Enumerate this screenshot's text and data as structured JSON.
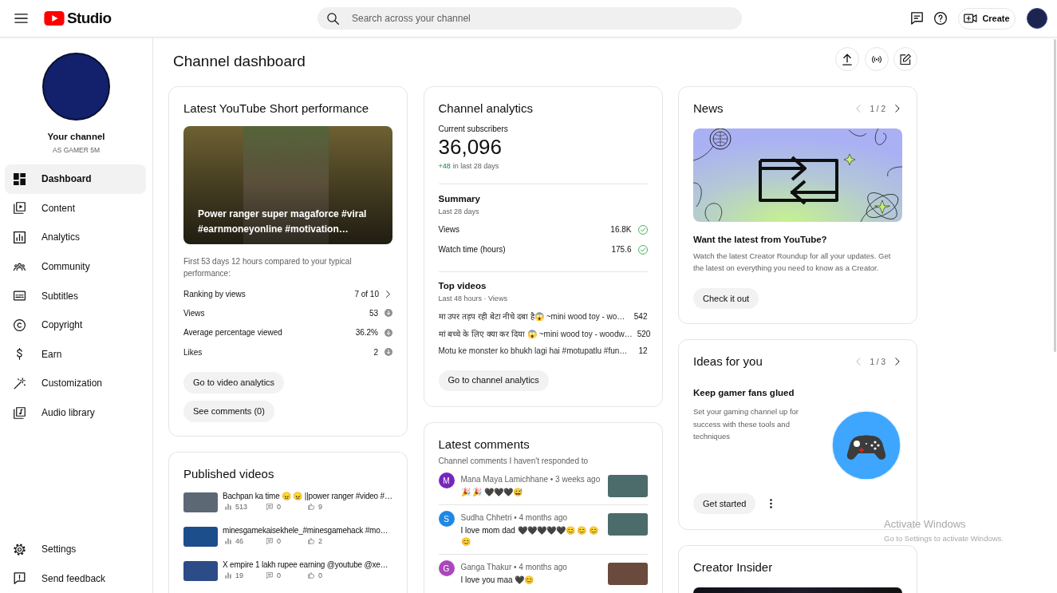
{
  "header": {
    "brand": "Studio",
    "search": {
      "placeholder": "Search across your channel"
    },
    "create_button": "Create"
  },
  "sidebar": {
    "channel": {
      "title": "Your channel",
      "name": "AS GAMER 5M"
    },
    "items": [
      {
        "label": "Dashboard",
        "selected": true
      },
      {
        "label": "Content",
        "selected": false
      },
      {
        "label": "Analytics",
        "selected": false
      },
      {
        "label": "Community",
        "selected": false
      },
      {
        "label": "Subtitles",
        "selected": false
      },
      {
        "label": "Copyright",
        "selected": false
      },
      {
        "label": "Earn",
        "selected": false
      },
      {
        "label": "Customization",
        "selected": false
      },
      {
        "label": "Audio library",
        "selected": false
      }
    ],
    "footer_items": [
      {
        "label": "Settings"
      },
      {
        "label": "Send feedback"
      }
    ]
  },
  "page": {
    "title": "Channel dashboard"
  },
  "short_performance": {
    "title": "Latest YouTube Short performance",
    "video_title": "Power ranger super magaforce #viral #earnmoneyonline #motivation…",
    "note": "First 53 days 12 hours compared to your typical performance:",
    "metrics": [
      {
        "label": "Ranking by views",
        "value": "7 of 10",
        "kind": "link"
      },
      {
        "label": "Views",
        "value": "53",
        "kind": "below"
      },
      {
        "label": "Average percentage viewed",
        "value": "36.2%",
        "kind": "below"
      },
      {
        "label": "Likes",
        "value": "2",
        "kind": "below"
      }
    ],
    "buttons": [
      "Go to video analytics",
      "See comments (0)"
    ]
  },
  "published_videos": {
    "title": "Published videos",
    "videos": [
      {
        "title": "Bachpan ka time 😠 😠 ||power ranger #video #…",
        "views": "513",
        "comments": "0",
        "likes": "9"
      },
      {
        "title": "minesgamekaisekhele_#minesgamehack #mo…",
        "views": "46",
        "comments": "0",
        "likes": "2"
      },
      {
        "title": "X empire 1 lakh rupee earning @youtube @xe…",
        "views": "19",
        "comments": "0",
        "likes": "0"
      }
    ]
  },
  "channel_analytics": {
    "title": "Channel analytics",
    "subscribers_label": "Current subscribers",
    "subscribers": "36,096",
    "subscriber_change": "+48",
    "subscriber_change_period": "in last 28 days",
    "summary": {
      "title": "Summary",
      "period": "Last 28 days",
      "rows": [
        {
          "label": "Views",
          "value": "16.8K",
          "kind": "typical"
        },
        {
          "label": "Watch time (hours)",
          "value": "175.6",
          "kind": "typical"
        }
      ]
    },
    "top_videos": {
      "title": "Top videos",
      "period": "Last 48 hours · Views",
      "rows": [
        {
          "title": "मा उपर तड़प रही बेटा नीचे दबा है😱 ~mini wood toy - wo…",
          "views": "542"
        },
        {
          "title": "मां बच्चे के लिए क्या कर दिया 😱 ~mini wood toy - woodw…",
          "views": "520"
        },
        {
          "title": "Motu ke monster ko bhukh lagi hai #motupatlu #fun…",
          "views": "12"
        }
      ]
    },
    "button": "Go to channel analytics"
  },
  "latest_comments": {
    "title": "Latest comments",
    "subtitle": "Channel comments I haven't responded to",
    "comments": [
      {
        "initial": "M",
        "color": "#7627bb",
        "byline": "Mana Maya Lamichhane • 3 weeks ago",
        "text": "🎉 🎉 🖤🖤🖤😅"
      },
      {
        "initial": "S",
        "color": "#1e88e5",
        "byline": "Sudha Chhetri • 4 months ago",
        "text": "I love mom dad 🖤🖤🖤🖤🖤😊 😊 😊 😊"
      },
      {
        "initial": "G",
        "color": "#ab47bc",
        "byline": "Ganga Thakur • 4 months ago",
        "text": "I love you maa 🖤😊"
      }
    ]
  },
  "news": {
    "title": "News",
    "pager": {
      "label": "1 / 2",
      "prev_disabled": true,
      "next_disabled": false
    },
    "headline": "Want the latest from YouTube?",
    "body": "Watch the latest Creator Roundup for all your updates. Get the latest on everything you need to know as a Creator.",
    "button": "Check it out"
  },
  "ideas": {
    "title": "Ideas for you",
    "pager": {
      "label": "1 / 3",
      "prev_disabled": true,
      "next_disabled": false
    },
    "headline": "Keep gamer fans glued",
    "body": "Set your gaming channel up for success with these tools and techniques",
    "button": "Get started"
  },
  "creator_insider": {
    "title": "Creator Insider"
  },
  "os_notice": {
    "title": "Activate Windows",
    "body": "Go to Settings to activate Windows."
  }
}
